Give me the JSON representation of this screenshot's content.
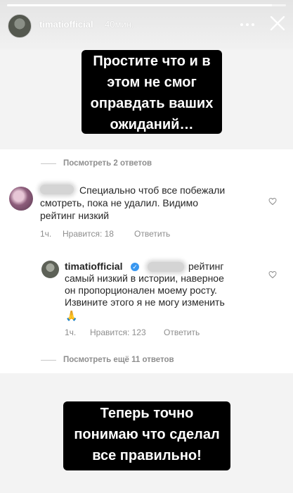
{
  "story": {
    "username": "timatiofficial",
    "time": "40мин.",
    "progress_fraction": 0.95
  },
  "captions": {
    "top": [
      "Простите что и в",
      "этом не смог",
      "оправдать ваших",
      "ожиданий…"
    ],
    "bottom": [
      "Теперь точно",
      "понимаю что сделал",
      "все правильно!"
    ]
  },
  "thread": {
    "view_replies_top": "Посмотреть 2 ответов",
    "comment1": {
      "lines": [
        "Специально чтоб все побежали",
        "смотреть, пока не удалил. Видимо",
        "рейтинг низкий"
      ],
      "time": "1ч.",
      "likes": "Нравится: 18",
      "reply": "Ответить"
    },
    "comment2": {
      "username": "timatiofficial",
      "lines": [
        "рейтинг",
        "самый низкий в истории, наверное",
        "он пропорционален моему росту.",
        "Извините этого я не могу изменить"
      ],
      "emoji": "🙏",
      "time": "1ч.",
      "likes": "Нравится: 123",
      "reply": "Ответить"
    },
    "view_replies_bottom": "Посмотреть ещё 11 ответов"
  },
  "icons": {
    "more": "more-icon",
    "close": "close-icon",
    "heart": "heart-icon",
    "verified": "verified-icon"
  },
  "colors": {
    "verified": "#3897f0",
    "meta_text": "#8e8e8e",
    "caption_bg": "#000000"
  }
}
